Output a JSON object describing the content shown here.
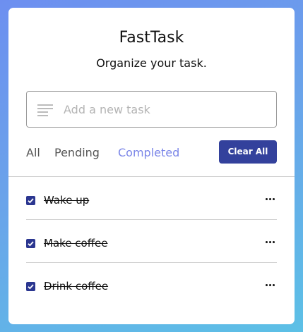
{
  "app": {
    "title": "FastTask",
    "subtitle": "Organize your task."
  },
  "input": {
    "placeholder": "Add a new task",
    "value": "",
    "icon": "notes-icon"
  },
  "filters": [
    {
      "label": "All",
      "active": false
    },
    {
      "label": "Pending",
      "active": false
    },
    {
      "label": "Completed",
      "active": true
    }
  ],
  "clear_button": {
    "label": "Clear All"
  },
  "tasks": [
    {
      "name": "Wake up",
      "completed": true
    },
    {
      "name": "Make coffee",
      "completed": true
    },
    {
      "name": "Drink coffee",
      "completed": true
    }
  ],
  "colors": {
    "accent": "#33419c",
    "active_filter": "#7b86e8",
    "background_start": "#6d8ff0",
    "background_end": "#5cc0e6"
  }
}
